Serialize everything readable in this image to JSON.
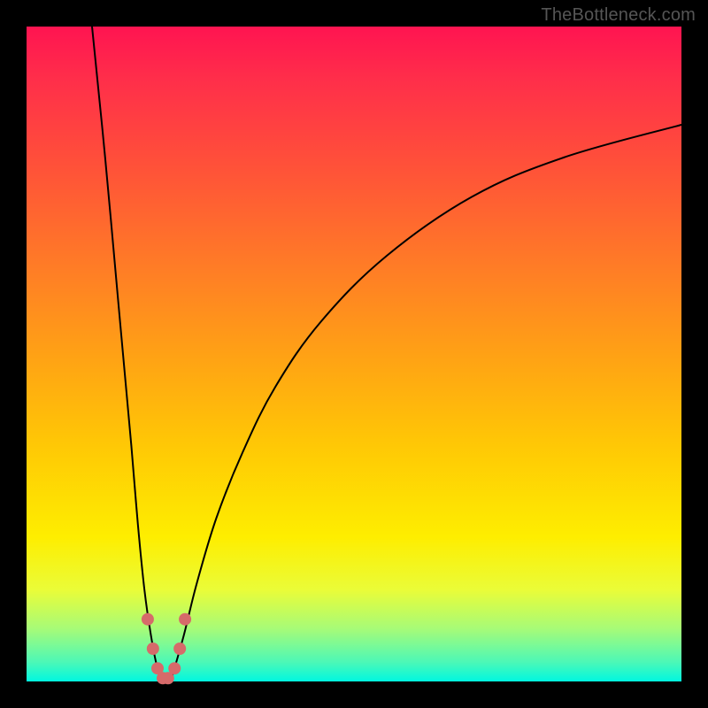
{
  "watermark": "TheBottleneck.com",
  "chart_data": {
    "type": "line",
    "title": "",
    "xlabel": "",
    "ylabel": "",
    "xlim": [
      0,
      100
    ],
    "ylim": [
      0,
      100
    ],
    "series": [
      {
        "name": "left-branch",
        "x": [
          10,
          12,
          14,
          16,
          17,
          18,
          19,
          20,
          21
        ],
        "y": [
          100,
          80,
          58,
          36,
          24,
          14,
          7,
          2,
          0
        ]
      },
      {
        "name": "right-branch",
        "x": [
          22,
          24,
          26,
          29,
          33,
          38,
          45,
          55,
          68,
          82,
          100
        ],
        "y": [
          0,
          7,
          15,
          25,
          35,
          45,
          55,
          65,
          74,
          80,
          85
        ]
      }
    ],
    "markers": {
      "name": "highlight-points",
      "x": [
        18.5,
        19.3,
        20.0,
        20.8,
        21.6,
        22.6,
        23.4,
        24.2
      ],
      "y": [
        9.5,
        5.0,
        2.0,
        0.5,
        0.5,
        2.0,
        5.0,
        9.5
      ],
      "color": "#d66a6a",
      "radius_px": 7
    },
    "background_gradient": {
      "orientation": "vertical",
      "stops": [
        {
          "pos": 0.0,
          "color": "#ff1451"
        },
        {
          "pos": 0.22,
          "color": "#ff5338"
        },
        {
          "pos": 0.5,
          "color": "#ffa115"
        },
        {
          "pos": 0.78,
          "color": "#feee00"
        },
        {
          "pos": 0.92,
          "color": "#a6fb78"
        },
        {
          "pos": 1.0,
          "color": "#00f7e0"
        }
      ]
    }
  }
}
